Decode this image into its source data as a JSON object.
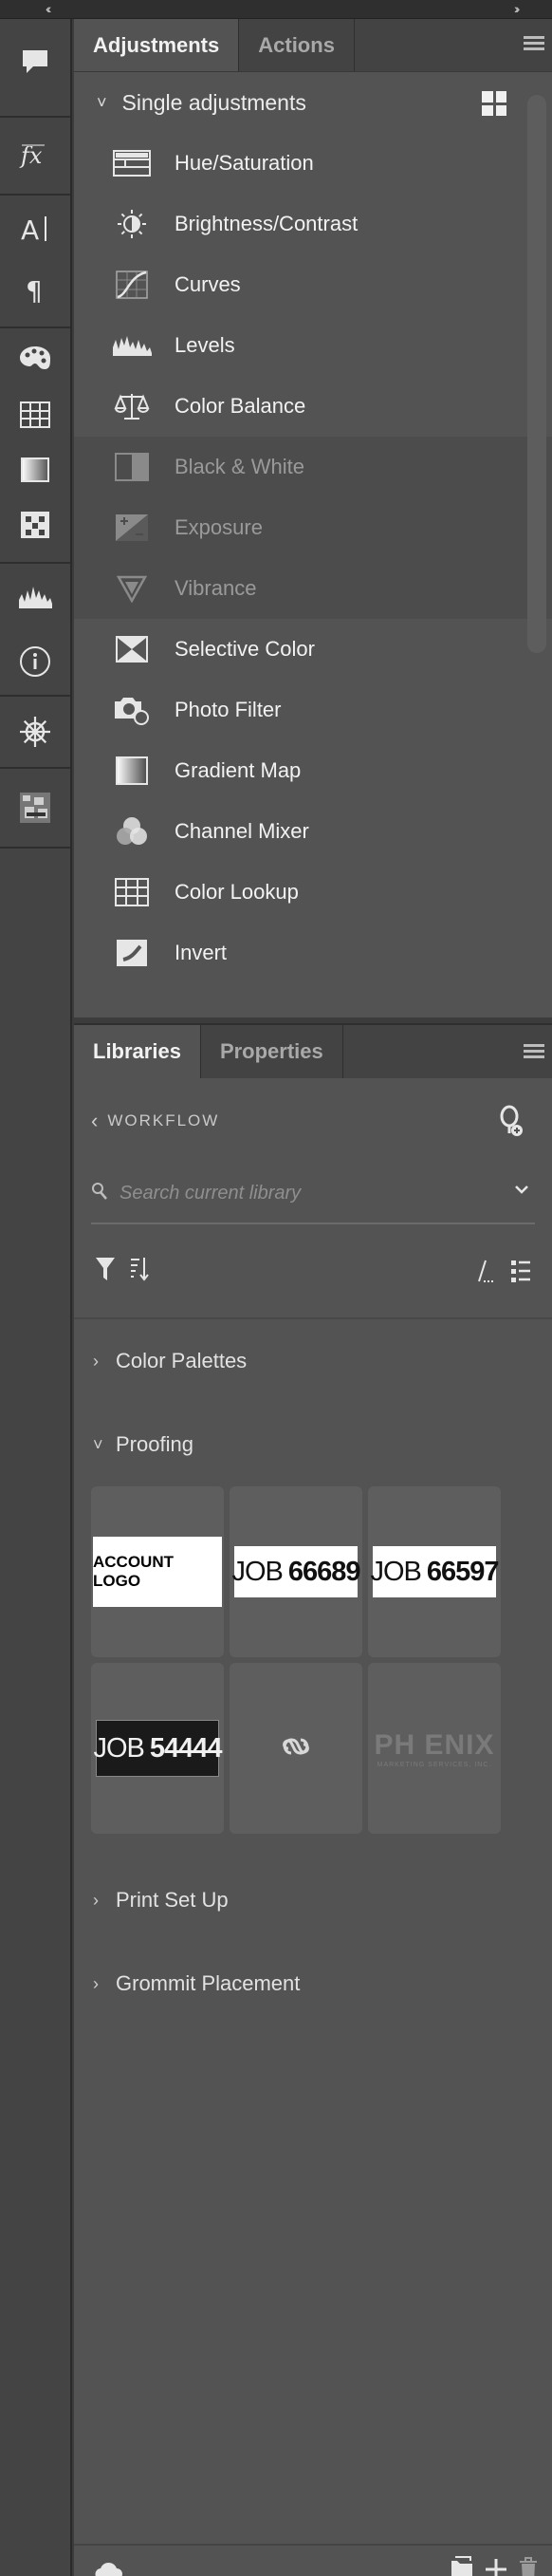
{
  "adjustments_panel": {
    "tabs": [
      "Adjustments",
      "Actions"
    ],
    "section_title": "Single adjustments",
    "items": [
      {
        "label": "Hue/Saturation",
        "icon": "hue-saturation-icon",
        "enabled": true
      },
      {
        "label": "Brightness/Contrast",
        "icon": "brightness-icon",
        "enabled": true
      },
      {
        "label": "Curves",
        "icon": "curves-icon",
        "enabled": true
      },
      {
        "label": "Levels",
        "icon": "levels-icon",
        "enabled": true
      },
      {
        "label": "Color Balance",
        "icon": "color-balance-icon",
        "enabled": true
      },
      {
        "label": "Black & White",
        "icon": "black-white-icon",
        "enabled": false
      },
      {
        "label": "Exposure",
        "icon": "exposure-icon",
        "enabled": false
      },
      {
        "label": "Vibrance",
        "icon": "vibrance-icon",
        "enabled": false
      },
      {
        "label": "Selective Color",
        "icon": "selective-color-icon",
        "enabled": true
      },
      {
        "label": "Photo Filter",
        "icon": "photo-filter-icon",
        "enabled": true
      },
      {
        "label": "Gradient Map",
        "icon": "gradient-map-icon",
        "enabled": true
      },
      {
        "label": "Channel Mixer",
        "icon": "channel-mixer-icon",
        "enabled": true
      },
      {
        "label": "Color Lookup",
        "icon": "color-lookup-icon",
        "enabled": true
      },
      {
        "label": "Invert",
        "icon": "invert-icon",
        "enabled": true
      }
    ]
  },
  "libraries_panel": {
    "tabs": [
      "Libraries",
      "Properties"
    ],
    "library_name": "WORKFLOW",
    "search_placeholder": "Search current library",
    "groups": [
      {
        "label": "Color Palettes",
        "expanded": false
      },
      {
        "label": "Proofing",
        "expanded": true
      },
      {
        "label": "Print Set Up",
        "expanded": false
      },
      {
        "label": "Grommit Placement",
        "expanded": false
      }
    ],
    "proofing_assets": {
      "account_logo": "ACCOUNT LOGO",
      "job1": {
        "prefix": "JOB",
        "number": "66689"
      },
      "job2": {
        "prefix": "JOB",
        "number": "66597"
      },
      "job3": {
        "prefix": "JOB",
        "number": "54444"
      },
      "phoenix_big": "PH   ENIX",
      "phoenix_small": "MARKETING SERVICES, INC."
    }
  },
  "colors": {
    "panel_bg": "#535353",
    "rail_bg": "#444444",
    "tab_bar_bg": "#434343"
  }
}
